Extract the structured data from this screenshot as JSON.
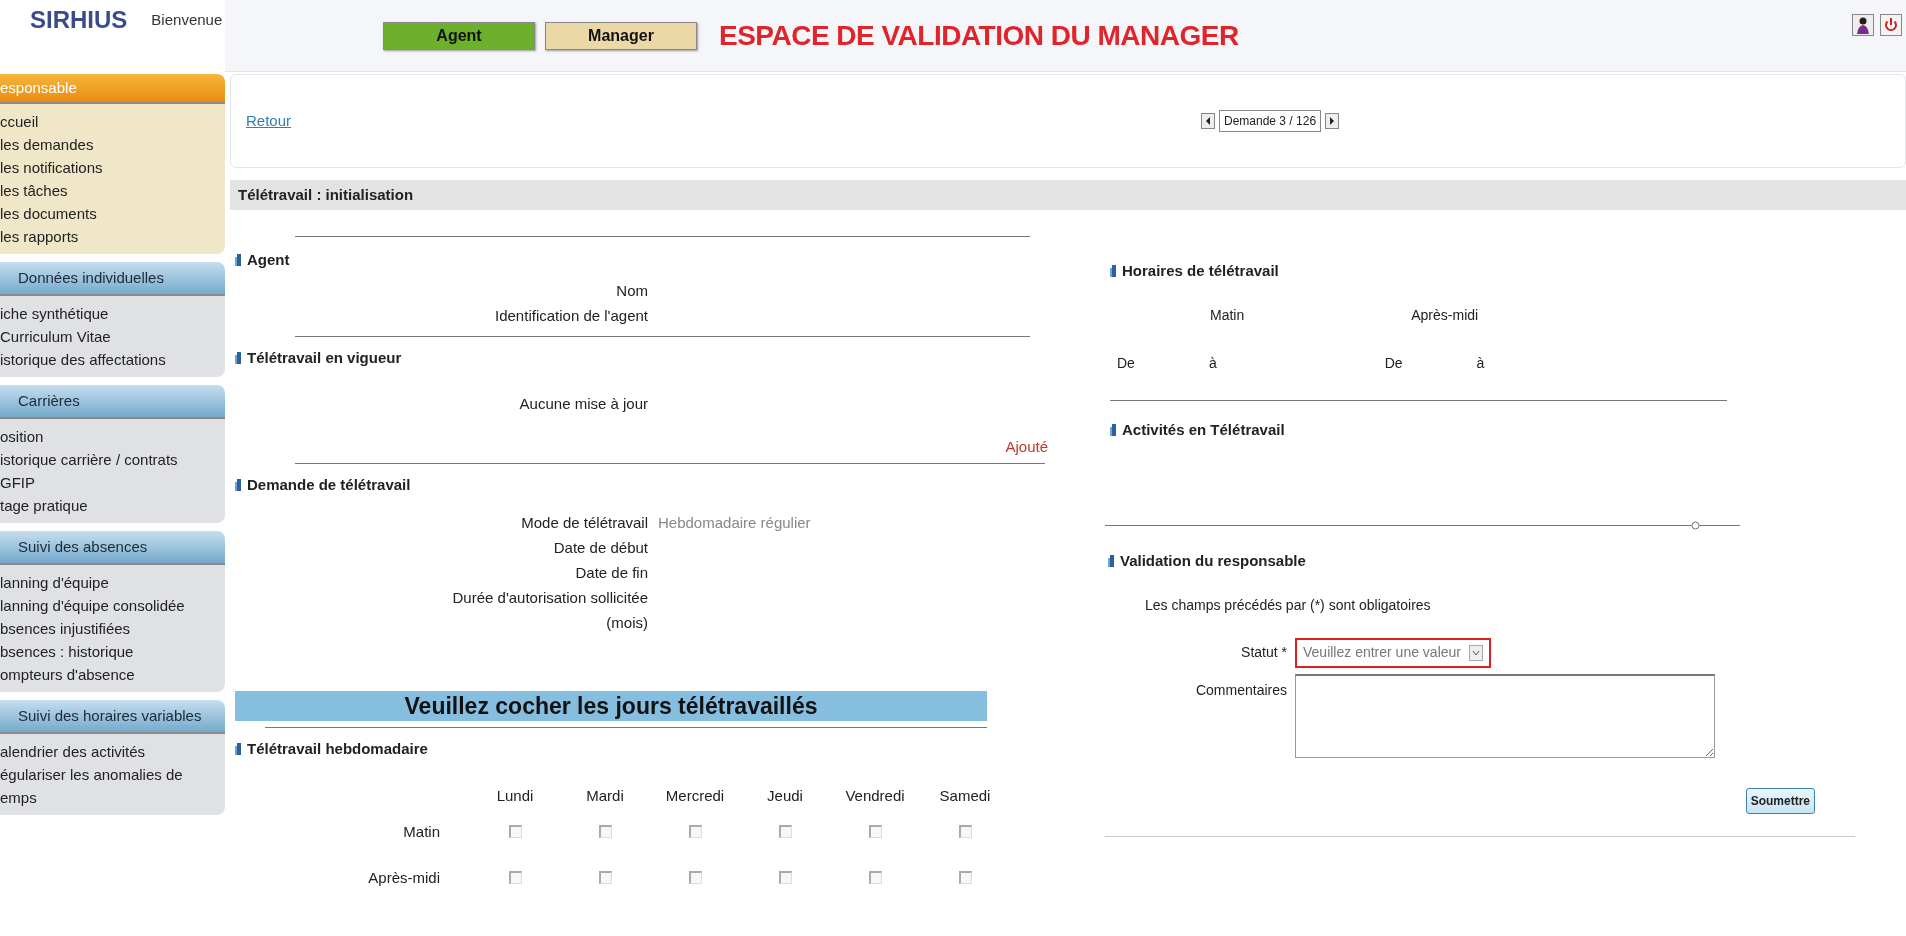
{
  "header": {
    "logo": "SIRHIUS",
    "greeting": "Bienvenue",
    "role_tabs": [
      {
        "label": "Agent",
        "color": "#6db02c"
      },
      {
        "label": "Manager",
        "color": "#ecd8a6"
      }
    ],
    "title": "ESPACE DE VALIDATION DU MANAGER"
  },
  "sidebar": {
    "sections": [
      {
        "title": "esponsable",
        "selected": true,
        "items": [
          "ccueil",
          "les demandes",
          "les notifications",
          "les tâches",
          "les documents",
          "les rapports"
        ]
      },
      {
        "title": "Données individuelles",
        "selected": false,
        "items": [
          "iche synthétique",
          "Curriculum Vitae",
          "istorique des affectations"
        ]
      },
      {
        "title": "Carrières",
        "selected": false,
        "items": [
          "osition",
          "istorique carrière / contrats",
          "GFIP",
          "tage pratique"
        ]
      },
      {
        "title": "Suivi des absences",
        "selected": false,
        "items": [
          "lanning d'équipe",
          "lanning d'équipe consolidée",
          "bsences injustifiées",
          "bsences : historique",
          "ompteurs d'absence"
        ]
      },
      {
        "title": "Suivi des horaires variables",
        "selected": false,
        "items": [
          "alendrier des activités",
          "égulariser les anomalies de",
          "emps"
        ]
      }
    ]
  },
  "nav": {
    "back_link": "Retour",
    "record": "Demande 3 / 126"
  },
  "section_title": "Télétravail : initialisation",
  "agent": {
    "heading": "Agent",
    "fields": [
      {
        "label": "Nom"
      },
      {
        "label": "Identification de l'agent"
      }
    ]
  },
  "current": {
    "heading": "Télétravail en vigueur",
    "message": "Aucune mise à jour",
    "status": "Ajouté"
  },
  "request": {
    "heading": "Demande de télétravail",
    "fields": [
      {
        "label": "Mode de télétravail",
        "value": "Hebdomadaire régulier"
      },
      {
        "label": "Date de début"
      },
      {
        "label": "Date de fin"
      },
      {
        "label": "Durée d'autorisation sollicitée (mois)"
      }
    ]
  },
  "banner": "Veuillez cocher les jours télétravaillés",
  "weekly": {
    "heading": "Télétravail hebdomadaire",
    "days": [
      "Lundi",
      "Mardi",
      "Mercredi",
      "Jeudi",
      "Vendredi",
      "Samedi"
    ],
    "rows": [
      {
        "label": "Matin",
        "checks": [
          {
            "checked": false
          },
          {
            "checked": false
          },
          {
            "checked": false
          },
          {
            "checked": false
          },
          {
            "checked": false
          },
          {
            "checked": false
          }
        ]
      },
      {
        "label": "Après-midi",
        "checks": [
          {
            "checked": false
          },
          {
            "checked": false
          },
          {
            "checked": false
          },
          {
            "checked": false
          },
          {
            "checked": false
          },
          {
            "checked": false
          }
        ]
      }
    ]
  },
  "hours": {
    "heading": "Horaires de télétravail",
    "columns": [
      "Matin",
      "Après-midi"
    ],
    "labels": [
      "De",
      "à",
      "De",
      "à"
    ]
  },
  "activities": {
    "heading": "Activités en Télétravail"
  },
  "validation": {
    "heading": "Validation du responsable",
    "note": "Les champs précédés par (*) sont obligatoires",
    "status_label": "Statut *",
    "status_placeholder": "Veuillez entrer une valeur",
    "status_invalid": true,
    "comments_label": "Commentaires",
    "submit": "Soumettre"
  }
}
